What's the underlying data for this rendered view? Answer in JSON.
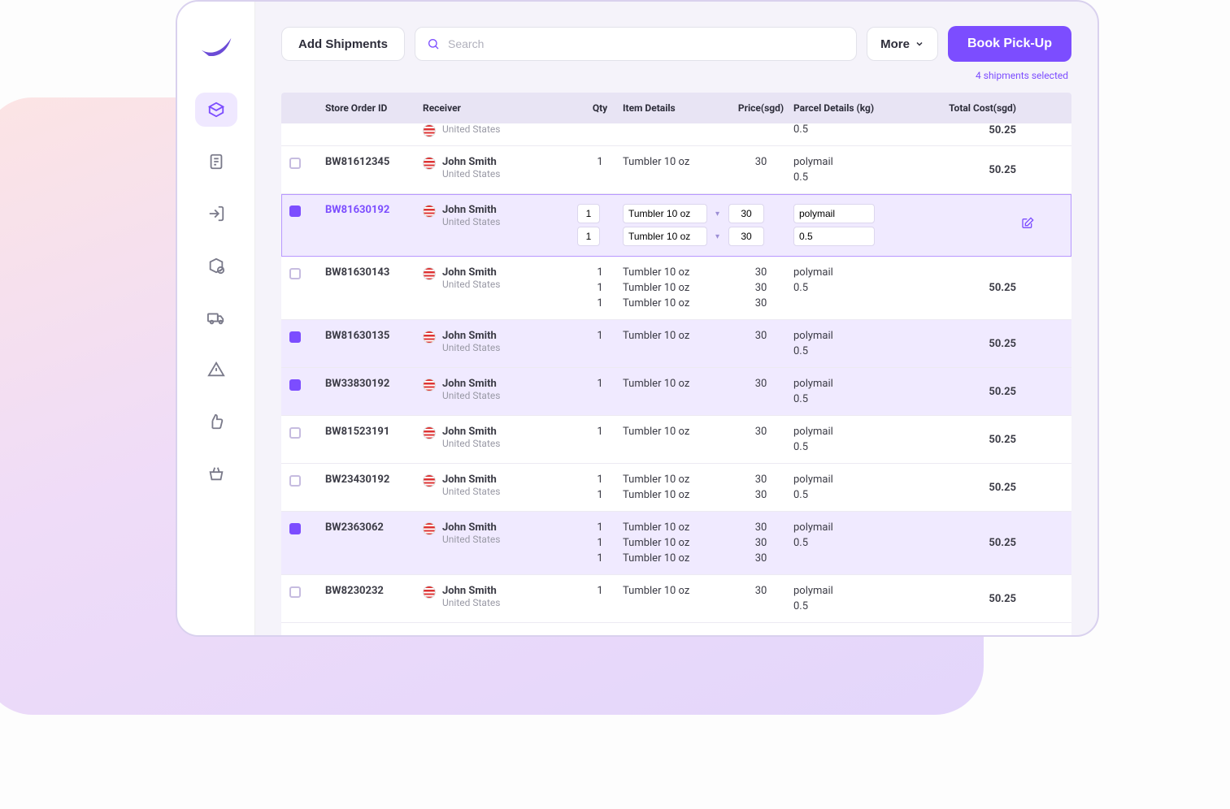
{
  "header": {
    "add_shipments": "Add Shipments",
    "search_placeholder": "Search",
    "more": "More",
    "book_pickup": "Book Pick-Up",
    "selected_note": "4 shipments selected"
  },
  "table": {
    "headers": {
      "order_id": "Store Order ID",
      "receiver": "Receiver",
      "qty": "Qty",
      "item_details": "Item Details",
      "price": "Price(sgd)",
      "parcel": "Parcel Details (kg)",
      "total": "Total Cost(sgd)"
    },
    "rows": [
      {
        "id": "BW81612345",
        "selected": false,
        "editing": false,
        "receiver": {
          "name": "John Smith",
          "country": "United States"
        },
        "items": [
          {
            "qty": "1",
            "name": "Tumbler 10 oz",
            "price": "30"
          }
        ],
        "parcel": {
          "type": "polymail",
          "weight": "0.5"
        },
        "total": "50.25"
      },
      {
        "id": "BW81630192",
        "selected": true,
        "editing": true,
        "receiver": {
          "name": "John Smith",
          "country": "United States"
        },
        "items": [
          {
            "qty": "1",
            "name": "Tumbler 10 oz",
            "price": "30"
          },
          {
            "qty": "1",
            "name": "Tumbler 10 oz",
            "price": "30"
          }
        ],
        "parcel": {
          "type": "polymail",
          "weight": "0.5"
        },
        "total": ""
      },
      {
        "id": "BW81630143",
        "selected": false,
        "editing": false,
        "receiver": {
          "name": "John Smith",
          "country": "United States"
        },
        "items": [
          {
            "qty": "1",
            "name": "Tumbler 10 oz",
            "price": "30"
          },
          {
            "qty": "1",
            "name": "Tumbler 10 oz",
            "price": "30"
          },
          {
            "qty": "1",
            "name": "Tumbler 10 oz",
            "price": "30"
          }
        ],
        "parcel": {
          "type": "polymail",
          "weight": "0.5"
        },
        "total": "50.25"
      },
      {
        "id": "BW81630135",
        "selected": true,
        "editing": false,
        "receiver": {
          "name": "John Smith",
          "country": "United States"
        },
        "items": [
          {
            "qty": "1",
            "name": "Tumbler 10 oz",
            "price": "30"
          }
        ],
        "parcel": {
          "type": "polymail",
          "weight": "0.5"
        },
        "total": "50.25"
      },
      {
        "id": "BW33830192",
        "selected": true,
        "editing": false,
        "receiver": {
          "name": "John Smith",
          "country": "United States"
        },
        "items": [
          {
            "qty": "1",
            "name": "Tumbler 10 oz",
            "price": "30"
          }
        ],
        "parcel": {
          "type": "polymail",
          "weight": "0.5"
        },
        "total": "50.25"
      },
      {
        "id": "BW81523191",
        "selected": false,
        "editing": false,
        "receiver": {
          "name": "John Smith",
          "country": "United States"
        },
        "items": [
          {
            "qty": "1",
            "name": "Tumbler 10 oz",
            "price": "30"
          }
        ],
        "parcel": {
          "type": "polymail",
          "weight": "0.5"
        },
        "total": "50.25"
      },
      {
        "id": "BW23430192",
        "selected": false,
        "editing": false,
        "receiver": {
          "name": "John Smith",
          "country": "United States"
        },
        "items": [
          {
            "qty": "1",
            "name": "Tumbler 10 oz",
            "price": "30"
          },
          {
            "qty": "1",
            "name": "Tumbler 10 oz",
            "price": "30"
          }
        ],
        "parcel": {
          "type": "polymail",
          "weight": "0.5"
        },
        "total": "50.25"
      },
      {
        "id": "BW2363062",
        "selected": true,
        "editing": false,
        "receiver": {
          "name": "John Smith",
          "country": "United States"
        },
        "items": [
          {
            "qty": "1",
            "name": "Tumbler 10 oz",
            "price": "30"
          },
          {
            "qty": "1",
            "name": "Tumbler 10 oz",
            "price": "30"
          },
          {
            "qty": "1",
            "name": "Tumbler 10 oz",
            "price": "30"
          }
        ],
        "parcel": {
          "type": "polymail",
          "weight": "0.5"
        },
        "total": "50.25"
      },
      {
        "id": "BW8230232",
        "selected": false,
        "editing": false,
        "receiver": {
          "name": "John Smith",
          "country": "United States"
        },
        "items": [
          {
            "qty": "1",
            "name": "Tumbler 10 oz",
            "price": "30"
          }
        ],
        "parcel": {
          "type": "polymail",
          "weight": "0.5"
        },
        "total": "50.25"
      }
    ]
  },
  "partial_top": {
    "country": "United States",
    "weight": "0.5",
    "total": "50.25"
  }
}
